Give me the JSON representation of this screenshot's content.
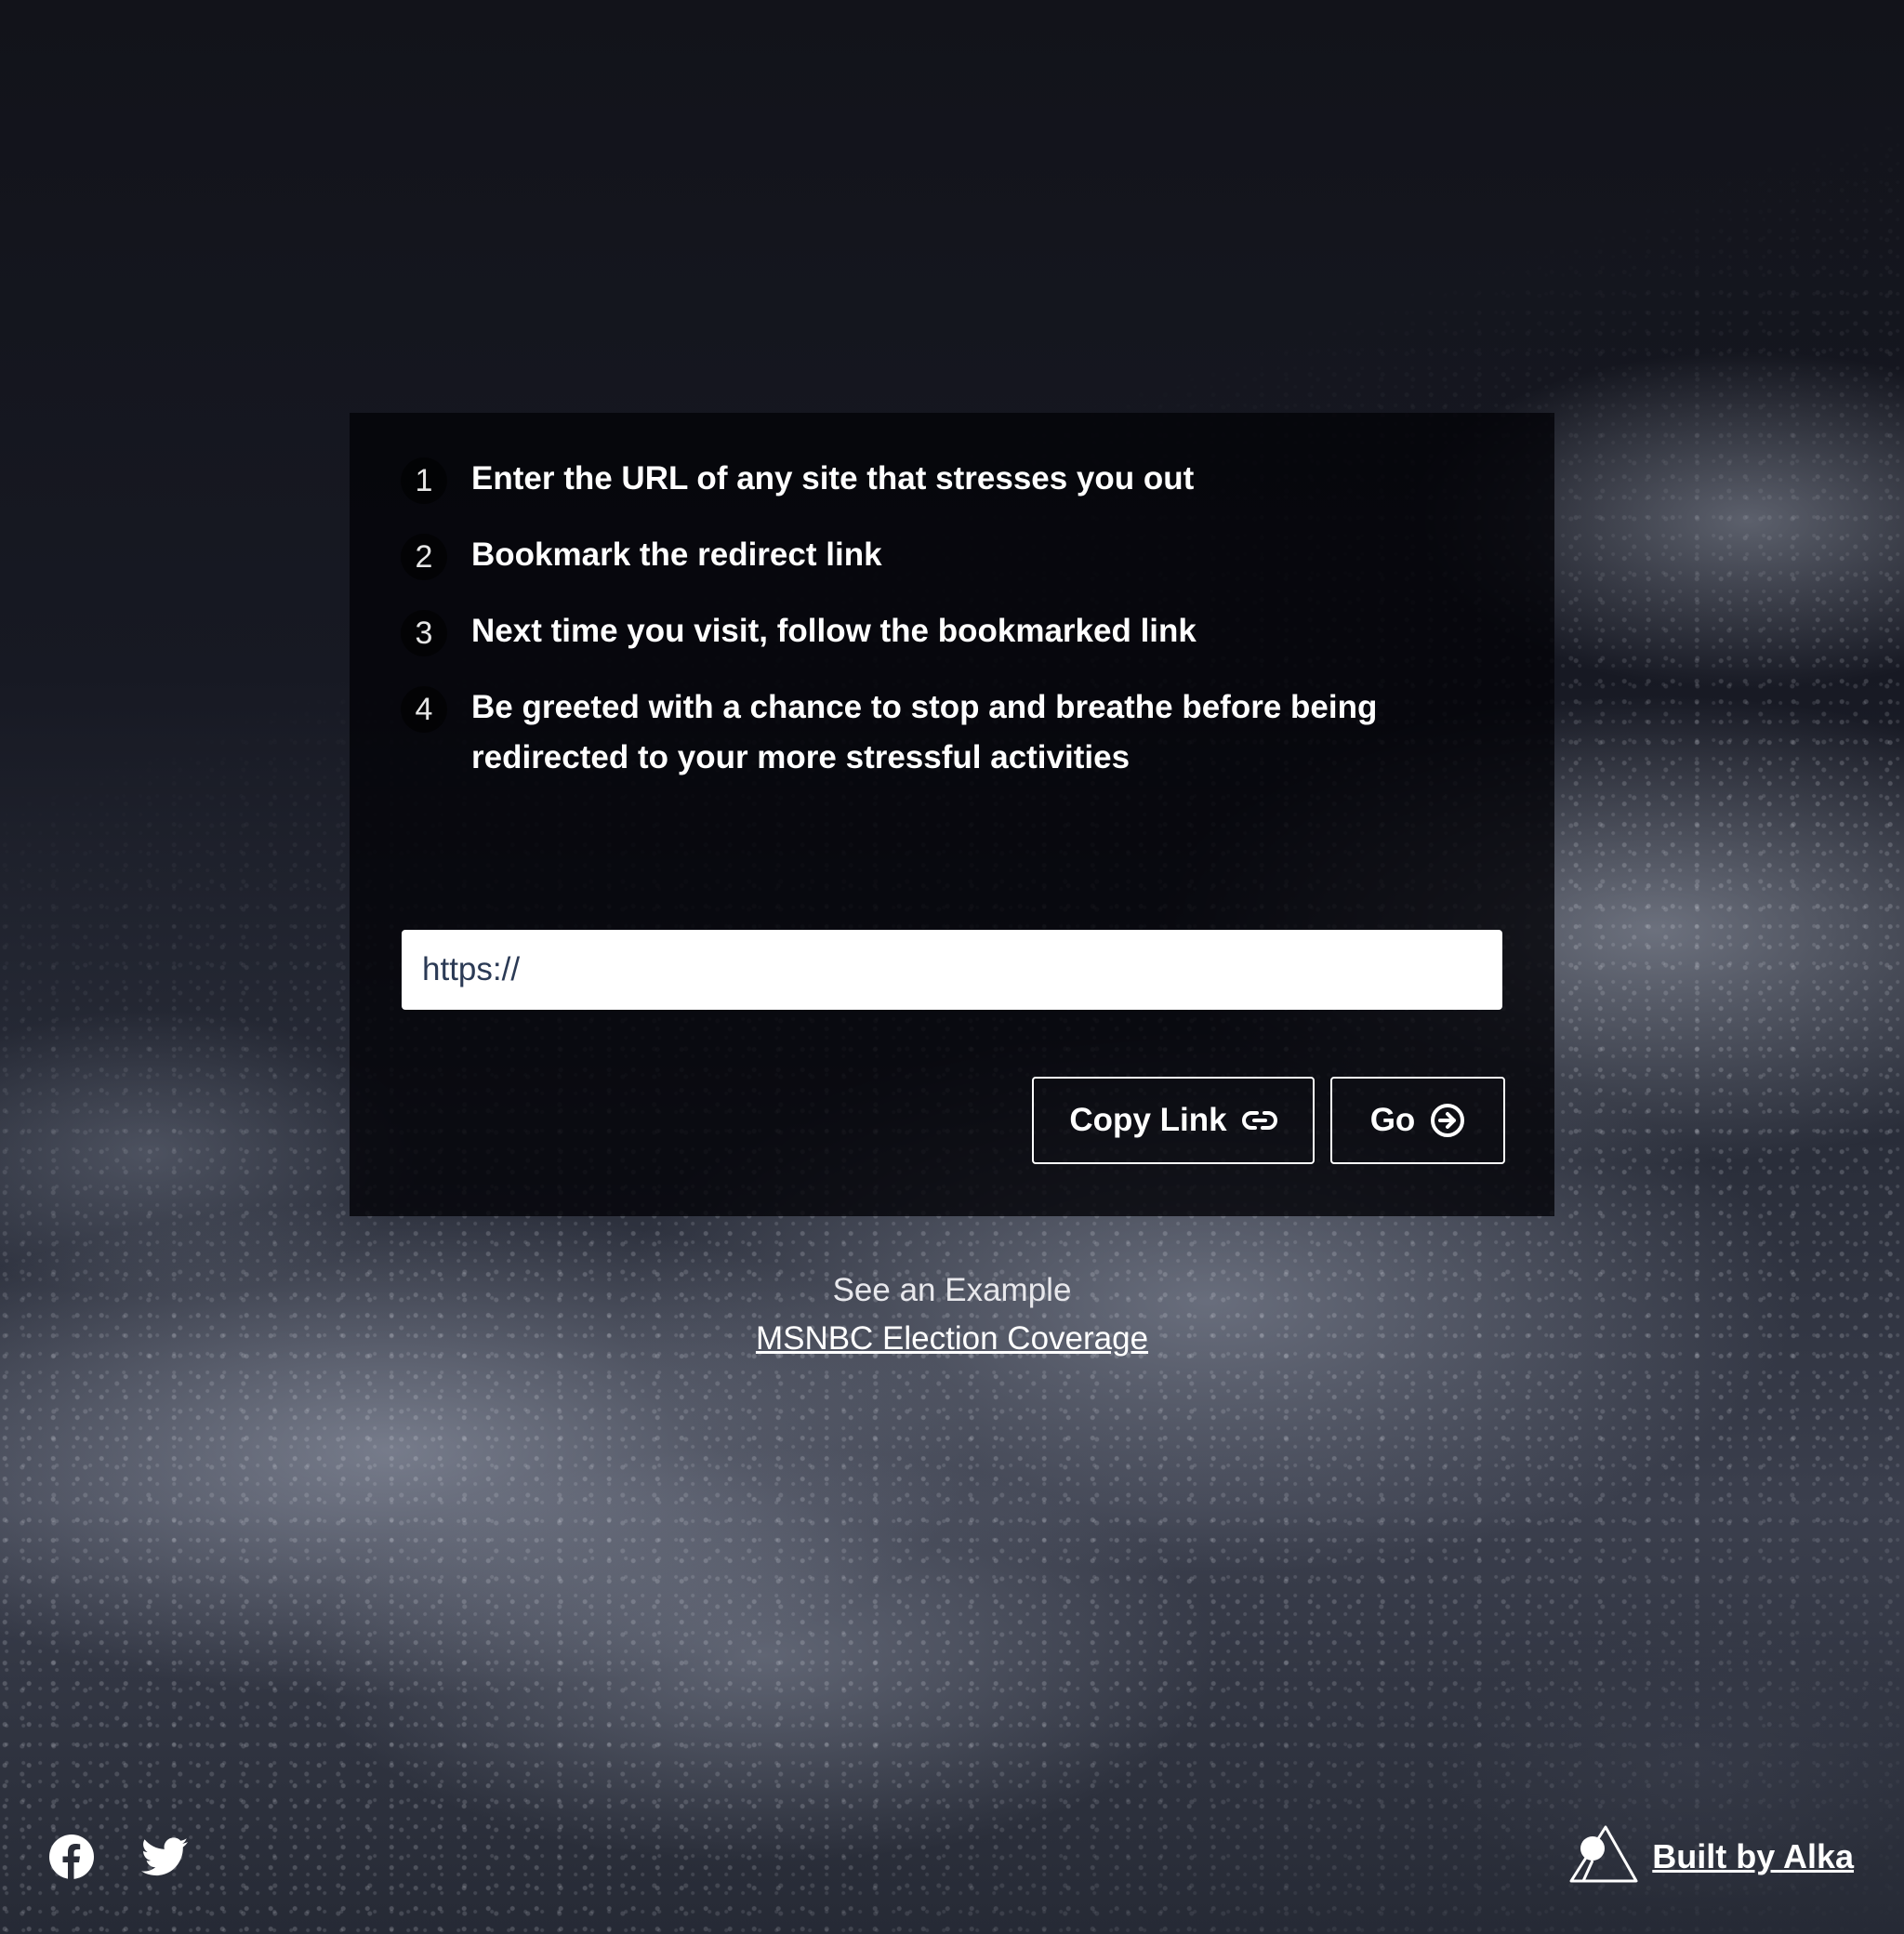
{
  "steps": [
    {
      "number": "1",
      "text": "Enter the URL of any site that stresses you out"
    },
    {
      "number": "2",
      "text": "Bookmark the redirect link"
    },
    {
      "number": "3",
      "text": "Next time you visit, follow the bookmarked link"
    },
    {
      "number": "4",
      "text": "Be greeted with a chance to stop and breathe before being redirected to your more stressful activities"
    }
  ],
  "url_input": {
    "value": "",
    "placeholder": "https://"
  },
  "buttons": {
    "copy_link": {
      "label": "Copy Link",
      "icon": "link-icon"
    },
    "go": {
      "label": "Go",
      "icon": "arrow-circle-right-icon"
    }
  },
  "example": {
    "label": "See an Example",
    "link_text": "MSNBC Election Coverage"
  },
  "footer": {
    "social_icons": [
      "facebook-icon",
      "twitter-icon"
    ],
    "credit_text": "Built by Alka",
    "credit_logo": "alka-logo-icon"
  },
  "colors": {
    "panel_background": "#040408",
    "text": "#ffffff",
    "input_text": "#2b3a55"
  }
}
